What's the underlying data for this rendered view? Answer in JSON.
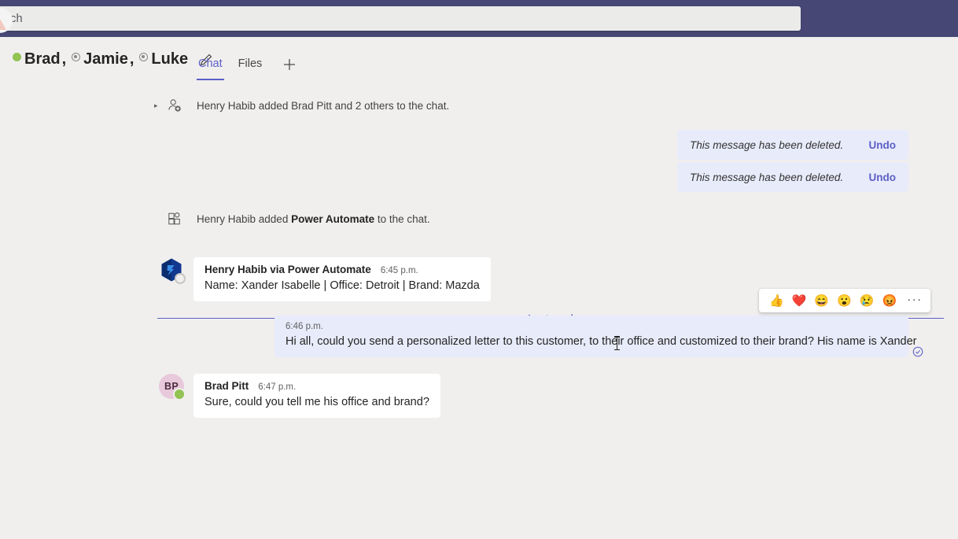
{
  "search": {
    "visible_text": "arch",
    "placeholder": "Search"
  },
  "chat_header": {
    "participants": [
      {
        "name": "Brad",
        "presence": "available"
      },
      {
        "name": "Jamie",
        "presence": "away"
      },
      {
        "name": "Luke",
        "presence": "away"
      }
    ],
    "separator": ",",
    "edit_icon": "pencil-icon",
    "tabs": [
      {
        "label": "Chat",
        "active": true
      },
      {
        "label": "Files",
        "active": false
      }
    ],
    "add_tab_icon": "plus-icon"
  },
  "messages": {
    "system_added_members": {
      "icon": "add-person-icon",
      "text_full": "Henry Habib added Brad Pitt and 2 others to the chat.",
      "prefix": "Henry Habib added Brad Pitt and 2 others to the chat."
    },
    "deleted": [
      {
        "text": "This message has been deleted.",
        "undo_label": "Undo"
      },
      {
        "text": "This message has been deleted.",
        "undo_label": "Undo"
      }
    ],
    "system_added_app": {
      "icon": "apps-grid-icon",
      "prefix": "Henry Habib added ",
      "app_name": "Power Automate",
      "suffix": " to the chat."
    },
    "last_read_label": "Last read",
    "bot_message": {
      "avatar_icon": "power-automate-logo",
      "author": "Henry Habib via Power Automate",
      "time": "6:45 p.m.",
      "body": "Name: Xander Isabelle | Office: Detroit | Brand: Mazda"
    },
    "self_message": {
      "time": "6:46 p.m.",
      "body": "Hi all, could you send a personalized letter to this customer, to their office and customized to their brand? His name is Xander",
      "read_receipt_icon": "read-check-icon"
    },
    "reply_message": {
      "avatar_initials": "BP",
      "author": "Brad Pitt",
      "time": "6:47 p.m.",
      "body": "Sure, could you tell me his office and brand?",
      "presence": "available"
    }
  },
  "reaction_bar": {
    "reactions": [
      {
        "name": "thumbs-up-reaction",
        "glyph": "👍"
      },
      {
        "name": "heart-reaction",
        "glyph": "❤️"
      },
      {
        "name": "laugh-reaction",
        "glyph": "😄"
      },
      {
        "name": "surprised-reaction",
        "glyph": "😮"
      },
      {
        "name": "sad-reaction",
        "glyph": "😢"
      },
      {
        "name": "angry-reaction",
        "glyph": "😡"
      }
    ],
    "more_label": "···"
  },
  "colors": {
    "brand_purple": "#464775",
    "accent_purple": "#5b5fc7",
    "self_bubble": "#e8ebfa",
    "app_background": "#f0efee",
    "available_green": "#92c353"
  }
}
